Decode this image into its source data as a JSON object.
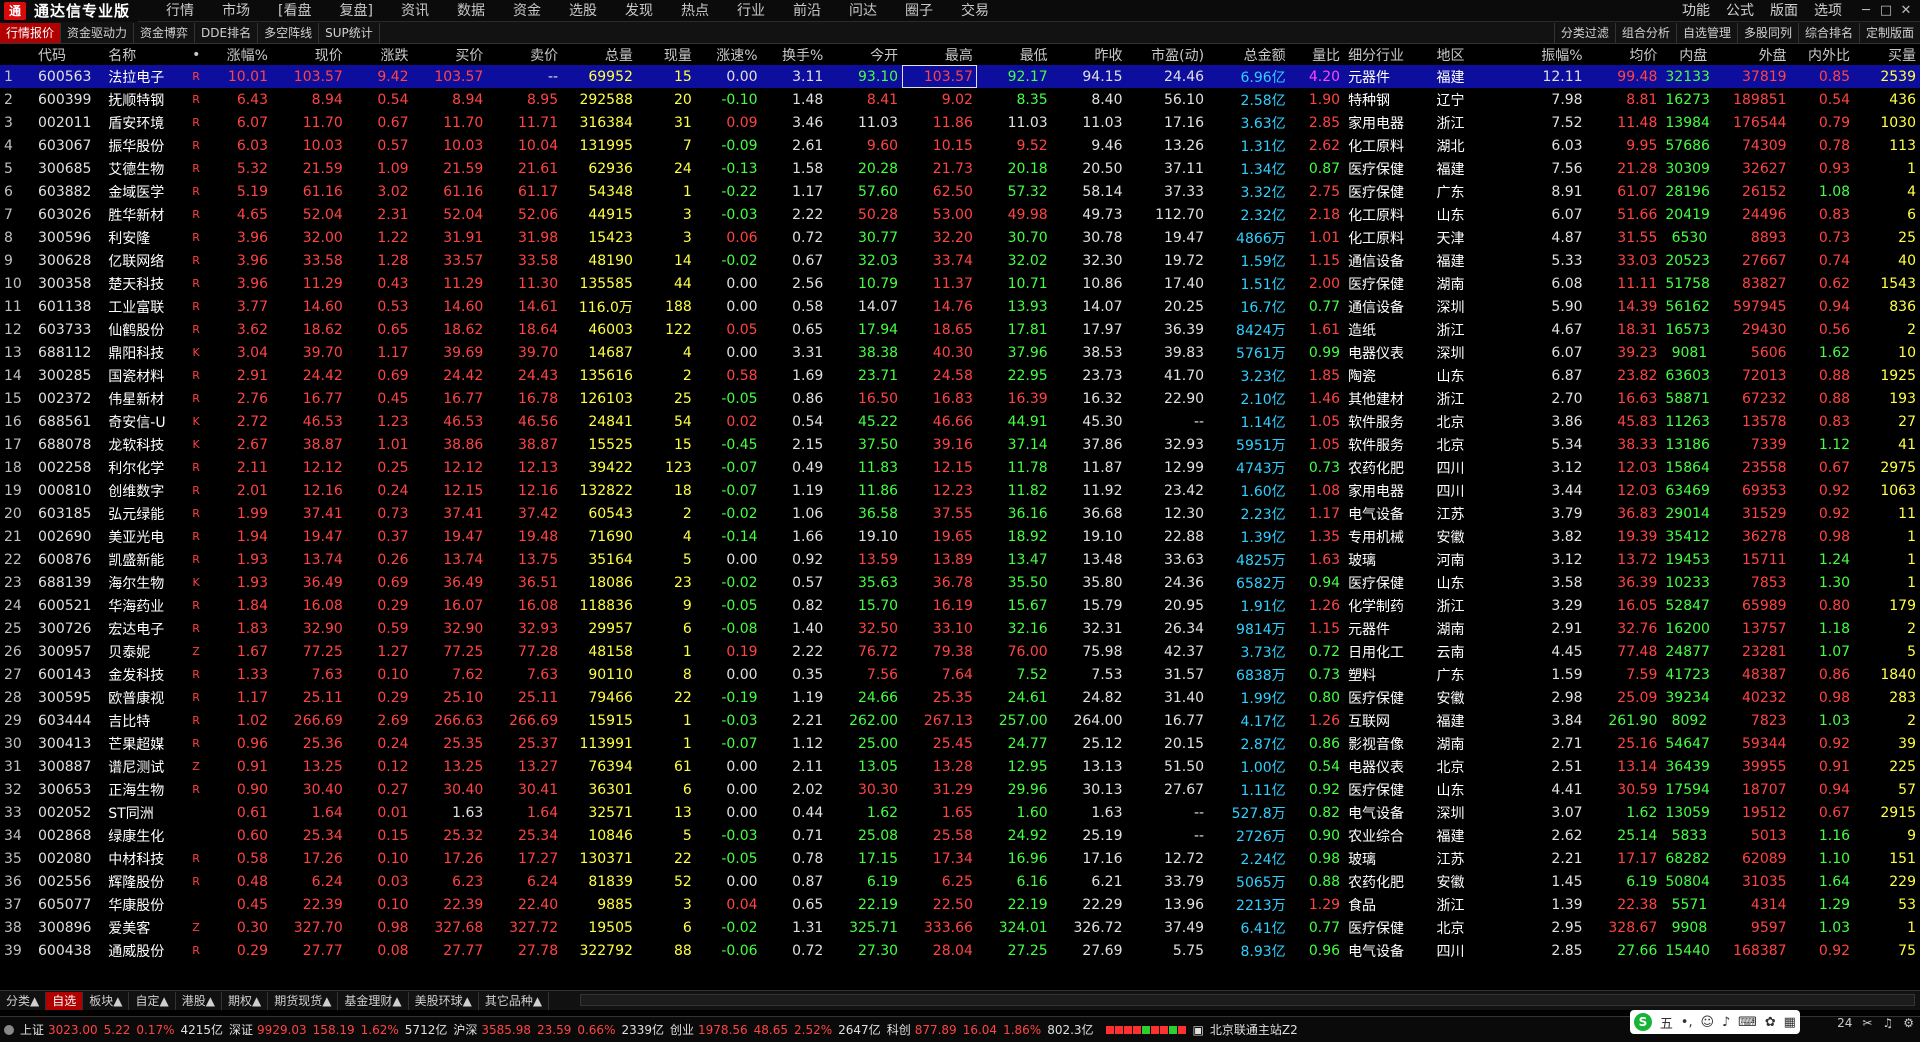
{
  "app": {
    "title": "通达信专业版",
    "logo": "通"
  },
  "menus": [
    "行情",
    "市场",
    "[看盘",
    "复盘]",
    "资讯",
    "数据",
    "资金",
    "选股",
    "发现",
    "热点",
    "行业",
    "前沿",
    "问达",
    "圈子",
    "交易"
  ],
  "right_menus": [
    "功能",
    "公式",
    "版面",
    "选项"
  ],
  "window_controls": [
    "─",
    "□",
    "✕"
  ],
  "sub_tabs": [
    "行情报价",
    "资金驱动力",
    "资金博弈",
    "DDE排名",
    "多空阵线",
    "SUP统计"
  ],
  "sub_tabs_right": [
    "分类过滤",
    "组合分析",
    "自选管理",
    "多股同列",
    "综合排名",
    "定制版面"
  ],
  "columns": [
    "",
    "代码",
    "名称",
    "•",
    "涨幅%",
    "现价",
    "涨跌",
    "买价",
    "卖价",
    "总量",
    "现量",
    "涨速%",
    "换手%",
    "今开",
    "最高",
    "最低",
    "昨收",
    "市盈(动)",
    "总金额",
    "量比",
    "细分行业",
    "地区",
    "振幅%",
    "均价",
    "内盘",
    "外盘",
    "内外比",
    "买量"
  ],
  "rows": [
    [
      "1",
      "600563",
      "法拉电子",
      "R",
      "10.01",
      "103.57",
      "9.42",
      "103.57",
      "--",
      "69952",
      "15",
      "0.00",
      "3.11",
      "93.10",
      "103.57",
      "92.17",
      "94.15",
      "24.46",
      "6.96亿",
      "4.20",
      "元器件",
      "福建",
      "12.11",
      "99.48",
      "32133",
      "37819",
      "0.85",
      "2539"
    ],
    [
      "2",
      "600399",
      "抚顺特钢",
      "R",
      "6.43",
      "8.94",
      "0.54",
      "8.94",
      "8.95",
      "292588",
      "20",
      "-0.10",
      "1.48",
      "8.41",
      "9.02",
      "8.35",
      "8.40",
      "56.10",
      "2.58亿",
      "1.90",
      "特种钢",
      "辽宁",
      "7.98",
      "8.81",
      "162737",
      "189851",
      "0.54",
      "436"
    ],
    [
      "3",
      "002011",
      "盾安环境",
      "R",
      "6.07",
      "11.70",
      "0.67",
      "11.70",
      "11.71",
      "316384",
      "31",
      "0.09",
      "3.46",
      "11.03",
      "11.86",
      "11.03",
      "11.03",
      "17.16",
      "3.63亿",
      "2.85",
      "家用电器",
      "浙江",
      "7.52",
      "11.48",
      "139840",
      "176544",
      "0.79",
      "1030"
    ],
    [
      "4",
      "603067",
      "振华股份",
      "R",
      "6.03",
      "10.03",
      "0.57",
      "10.03",
      "10.04",
      "131995",
      "7",
      "-0.09",
      "2.61",
      "9.60",
      "10.15",
      "9.52",
      "9.46",
      "13.26",
      "1.31亿",
      "2.62",
      "化工原料",
      "湖北",
      "6.03",
      "9.95",
      "57686",
      "74309",
      "0.78",
      "113"
    ],
    [
      "5",
      "300685",
      "艾德生物",
      "R",
      "5.32",
      "21.59",
      "1.09",
      "21.59",
      "21.61",
      "62936",
      "24",
      "-0.13",
      "1.58",
      "20.28",
      "21.73",
      "20.18",
      "20.50",
      "37.11",
      "1.34亿",
      "0.87",
      "医疗保健",
      "福建",
      "7.56",
      "21.28",
      "30309",
      "32627",
      "0.93",
      "1"
    ],
    [
      "6",
      "603882",
      "金域医学",
      "R",
      "5.19",
      "61.16",
      "3.02",
      "61.16",
      "61.17",
      "54348",
      "1",
      "-0.22",
      "1.17",
      "57.60",
      "62.50",
      "57.32",
      "58.14",
      "37.33",
      "3.32亿",
      "2.75",
      "医疗保健",
      "广东",
      "8.91",
      "61.07",
      "28196",
      "26152",
      "1.08",
      "4"
    ],
    [
      "7",
      "603026",
      "胜华新材",
      "R",
      "4.65",
      "52.04",
      "2.31",
      "52.04",
      "52.06",
      "44915",
      "3",
      "-0.03",
      "2.22",
      "50.28",
      "53.00",
      "49.98",
      "49.73",
      "112.70",
      "2.32亿",
      "2.18",
      "化工原料",
      "山东",
      "6.07",
      "51.66",
      "20419",
      "24496",
      "0.83",
      "6"
    ],
    [
      "8",
      "300596",
      "利安隆",
      "R",
      "3.96",
      "32.00",
      "1.22",
      "31.91",
      "31.98",
      "15423",
      "3",
      "0.06",
      "0.72",
      "30.77",
      "32.20",
      "30.70",
      "30.78",
      "19.47",
      "4866万",
      "1.01",
      "化工原料",
      "天津",
      "4.87",
      "31.55",
      "6530",
      "8893",
      "0.73",
      "25"
    ],
    [
      "9",
      "300628",
      "亿联网络",
      "R",
      "3.96",
      "33.58",
      "1.28",
      "33.57",
      "33.58",
      "48190",
      "14",
      "-0.02",
      "0.67",
      "32.03",
      "33.74",
      "32.02",
      "32.30",
      "19.72",
      "1.59亿",
      "1.15",
      "通信设备",
      "福建",
      "5.33",
      "33.03",
      "20523",
      "27667",
      "0.74",
      "40"
    ],
    [
      "10",
      "300358",
      "楚天科技",
      "R",
      "3.96",
      "11.29",
      "0.43",
      "11.29",
      "11.30",
      "135585",
      "44",
      "0.00",
      "2.56",
      "10.79",
      "11.37",
      "10.71",
      "10.86",
      "17.40",
      "1.51亿",
      "2.00",
      "医疗保健",
      "湖南",
      "6.08",
      "11.11",
      "51758",
      "83827",
      "0.62",
      "1543"
    ],
    [
      "11",
      "601138",
      "工业富联",
      "R",
      "3.77",
      "14.60",
      "0.53",
      "14.60",
      "14.61",
      "116.0万",
      "188",
      "0.00",
      "0.58",
      "14.07",
      "14.76",
      "13.93",
      "14.07",
      "20.25",
      "16.7亿",
      "0.77",
      "通信设备",
      "深圳",
      "5.90",
      "14.39",
      "561621",
      "597945",
      "0.94",
      "836"
    ],
    [
      "12",
      "603733",
      "仙鹤股份",
      "R",
      "3.62",
      "18.62",
      "0.65",
      "18.62",
      "18.64",
      "46003",
      "122",
      "0.05",
      "0.65",
      "17.94",
      "18.65",
      "17.81",
      "17.97",
      "36.39",
      "8424万",
      "1.61",
      "造纸",
      "浙江",
      "4.67",
      "18.31",
      "16573",
      "29430",
      "0.56",
      "2"
    ],
    [
      "13",
      "688112",
      "鼎阳科技",
      "K",
      "3.04",
      "39.70",
      "1.17",
      "39.69",
      "39.70",
      "14687",
      "4",
      "0.00",
      "3.31",
      "38.38",
      "40.30",
      "37.96",
      "38.53",
      "39.83",
      "5761万",
      "0.99",
      "电器仪表",
      "深圳",
      "6.07",
      "39.23",
      "9081",
      "5606",
      "1.62",
      "10"
    ],
    [
      "14",
      "300285",
      "国瓷材料",
      "R",
      "2.91",
      "24.42",
      "0.69",
      "24.42",
      "24.43",
      "135616",
      "2",
      "0.58",
      "1.69",
      "23.71",
      "24.58",
      "22.95",
      "23.73",
      "41.70",
      "3.23亿",
      "1.85",
      "陶瓷",
      "山东",
      "6.87",
      "23.82",
      "63603",
      "72013",
      "0.88",
      "1925"
    ],
    [
      "15",
      "002372",
      "伟星新材",
      "R",
      "2.76",
      "16.77",
      "0.45",
      "16.77",
      "16.78",
      "126103",
      "25",
      "-0.05",
      "0.86",
      "16.50",
      "16.83",
      "16.39",
      "16.32",
      "22.90",
      "2.10亿",
      "1.46",
      "其他建材",
      "浙江",
      "2.70",
      "16.63",
      "58871",
      "67232",
      "0.88",
      "193"
    ],
    [
      "16",
      "688561",
      "奇安信-U",
      "K",
      "2.72",
      "46.53",
      "1.23",
      "46.53",
      "46.56",
      "24841",
      "54",
      "0.02",
      "0.54",
      "45.22",
      "46.66",
      "44.91",
      "45.30",
      "--",
      "1.14亿",
      "1.05",
      "软件服务",
      "北京",
      "3.86",
      "45.83",
      "11263",
      "13578",
      "0.83",
      "27"
    ],
    [
      "17",
      "688078",
      "龙软科技",
      "K",
      "2.67",
      "38.87",
      "1.01",
      "38.86",
      "38.87",
      "15525",
      "15",
      "-0.45",
      "2.15",
      "37.50",
      "39.16",
      "37.14",
      "37.86",
      "32.93",
      "5951万",
      "1.05",
      "软件服务",
      "北京",
      "5.34",
      "38.33",
      "13186",
      "7339",
      "1.12",
      "41"
    ],
    [
      "18",
      "002258",
      "利尔化学",
      "R",
      "2.11",
      "12.12",
      "0.25",
      "12.12",
      "12.13",
      "39422",
      "123",
      "-0.07",
      "0.49",
      "11.83",
      "12.15",
      "11.78",
      "11.87",
      "12.99",
      "4743万",
      "0.73",
      "农药化肥",
      "四川",
      "3.12",
      "12.03",
      "15864",
      "23558",
      "0.67",
      "2975"
    ],
    [
      "19",
      "000810",
      "创维数字",
      "R",
      "2.01",
      "12.16",
      "0.24",
      "12.15",
      "12.16",
      "132822",
      "18",
      "-0.07",
      "1.19",
      "11.86",
      "12.23",
      "11.82",
      "11.92",
      "23.42",
      "1.60亿",
      "1.08",
      "家用电器",
      "四川",
      "3.44",
      "12.03",
      "63469",
      "69353",
      "0.92",
      "1063"
    ],
    [
      "20",
      "603185",
      "弘元绿能",
      "R",
      "1.99",
      "37.41",
      "0.73",
      "37.41",
      "37.42",
      "60543",
      "2",
      "-0.02",
      "1.06",
      "36.58",
      "37.55",
      "36.16",
      "36.68",
      "12.30",
      "2.23亿",
      "1.17",
      "电气设备",
      "江苏",
      "3.79",
      "36.83",
      "29014",
      "31529",
      "0.92",
      "11"
    ],
    [
      "21",
      "002690",
      "美亚光电",
      "R",
      "1.94",
      "19.47",
      "0.37",
      "19.47",
      "19.48",
      "71690",
      "4",
      "-0.14",
      "1.66",
      "19.10",
      "19.65",
      "18.92",
      "19.10",
      "22.88",
      "1.39亿",
      "1.35",
      "专用机械",
      "安徽",
      "3.82",
      "19.39",
      "35412",
      "36278",
      "0.98",
      "1"
    ],
    [
      "22",
      "600876",
      "凯盛新能",
      "R",
      "1.93",
      "13.74",
      "0.26",
      "13.74",
      "13.75",
      "35164",
      "5",
      "0.00",
      "0.92",
      "13.59",
      "13.89",
      "13.47",
      "13.48",
      "33.63",
      "4825万",
      "1.63",
      "玻璃",
      "河南",
      "3.12",
      "13.72",
      "19453",
      "15711",
      "1.24",
      "1"
    ],
    [
      "23",
      "688139",
      "海尔生物",
      "K",
      "1.93",
      "36.49",
      "0.69",
      "36.49",
      "36.51",
      "18086",
      "23",
      "-0.02",
      "0.57",
      "35.63",
      "36.78",
      "35.50",
      "35.80",
      "24.36",
      "6582万",
      "0.94",
      "医疗保健",
      "山东",
      "3.58",
      "36.39",
      "10233",
      "7853",
      "1.30",
      "1"
    ],
    [
      "24",
      "600521",
      "华海药业",
      "R",
      "1.84",
      "16.08",
      "0.29",
      "16.07",
      "16.08",
      "118836",
      "9",
      "-0.05",
      "0.82",
      "15.70",
      "16.19",
      "15.67",
      "15.79",
      "20.95",
      "1.91亿",
      "1.26",
      "化学制药",
      "浙江",
      "3.29",
      "16.05",
      "52847",
      "65989",
      "0.80",
      "179"
    ],
    [
      "25",
      "300726",
      "宏达电子",
      "R",
      "1.83",
      "32.90",
      "0.59",
      "32.90",
      "32.93",
      "29957",
      "6",
      "-0.08",
      "1.40",
      "32.50",
      "33.10",
      "32.16",
      "32.31",
      "26.34",
      "9814万",
      "1.15",
      "元器件",
      "湖南",
      "2.91",
      "32.76",
      "16200",
      "13757",
      "1.18",
      "2"
    ],
    [
      "26",
      "300957",
      "贝泰妮",
      "Z",
      "1.67",
      "77.25",
      "1.27",
      "77.25",
      "77.28",
      "48158",
      "1",
      "0.19",
      "2.22",
      "76.72",
      "79.38",
      "76.00",
      "75.98",
      "42.37",
      "3.73亿",
      "0.72",
      "日用化工",
      "云南",
      "4.45",
      "77.48",
      "24877",
      "23281",
      "1.07",
      "5"
    ],
    [
      "27",
      "600143",
      "金发科技",
      "R",
      "1.33",
      "7.63",
      "0.10",
      "7.62",
      "7.63",
      "90110",
      "8",
      "0.00",
      "0.35",
      "7.56",
      "7.64",
      "7.52",
      "7.53",
      "31.57",
      "6838万",
      "0.73",
      "塑料",
      "广东",
      "1.59",
      "7.59",
      "41723",
      "48387",
      "0.86",
      "1840"
    ],
    [
      "28",
      "300595",
      "欧普康视",
      "R",
      "1.17",
      "25.11",
      "0.29",
      "25.10",
      "25.11",
      "79466",
      "22",
      "-0.19",
      "1.19",
      "24.66",
      "25.35",
      "24.61",
      "24.82",
      "31.40",
      "1.99亿",
      "0.80",
      "医疗保健",
      "安徽",
      "2.98",
      "25.09",
      "39234",
      "40232",
      "0.98",
      "283"
    ],
    [
      "29",
      "603444",
      "吉比特",
      "R",
      "1.02",
      "266.69",
      "2.69",
      "266.63",
      "266.69",
      "15915",
      "1",
      "-0.03",
      "2.21",
      "262.00",
      "267.13",
      "257.00",
      "264.00",
      "16.77",
      "4.17亿",
      "1.26",
      "互联网",
      "福建",
      "3.84",
      "261.90",
      "8092",
      "7823",
      "1.03",
      "2"
    ],
    [
      "30",
      "300413",
      "芒果超媒",
      "R",
      "0.96",
      "25.36",
      "0.24",
      "25.35",
      "25.37",
      "113991",
      "1",
      "-0.07",
      "1.12",
      "25.00",
      "25.45",
      "24.77",
      "25.12",
      "20.15",
      "2.87亿",
      "0.86",
      "影视音像",
      "湖南",
      "2.71",
      "25.16",
      "54647",
      "59344",
      "0.92",
      "39"
    ],
    [
      "31",
      "300887",
      "谱尼测试",
      "Z",
      "0.91",
      "13.25",
      "0.12",
      "13.25",
      "13.27",
      "76394",
      "61",
      "0.00",
      "2.11",
      "13.05",
      "13.28",
      "12.95",
      "13.13",
      "51.50",
      "1.00亿",
      "0.54",
      "电器仪表",
      "北京",
      "2.51",
      "13.14",
      "36439",
      "39955",
      "0.91",
      "225"
    ],
    [
      "32",
      "300653",
      "正海生物",
      "R",
      "0.90",
      "30.40",
      "0.27",
      "30.40",
      "30.41",
      "36301",
      "6",
      "0.00",
      "2.02",
      "30.30",
      "31.29",
      "29.96",
      "30.13",
      "27.67",
      "1.11亿",
      "0.92",
      "医疗保健",
      "山东",
      "4.41",
      "30.59",
      "17594",
      "18707",
      "0.94",
      "57"
    ],
    [
      "33",
      "002052",
      "ST同洲",
      "",
      "0.61",
      "1.64",
      "0.01",
      "1.63",
      "1.64",
      "32571",
      "13",
      "0.00",
      "0.44",
      "1.62",
      "1.65",
      "1.60",
      "1.63",
      "--",
      "527.8万",
      "0.82",
      "电气设备",
      "深圳",
      "3.07",
      "1.62",
      "13059",
      "19512",
      "0.67",
      "2915"
    ],
    [
      "34",
      "002868",
      "绿康生化",
      "",
      "0.60",
      "25.34",
      "0.15",
      "25.32",
      "25.34",
      "10846",
      "5",
      "-0.03",
      "0.71",
      "25.08",
      "25.58",
      "24.92",
      "25.19",
      "--",
      "2726万",
      "0.90",
      "农业综合",
      "福建",
      "2.62",
      "25.14",
      "5833",
      "5013",
      "1.16",
      "9"
    ],
    [
      "35",
      "002080",
      "中材科技",
      "R",
      "0.58",
      "17.26",
      "0.10",
      "17.26",
      "17.27",
      "130371",
      "22",
      "-0.05",
      "0.78",
      "17.15",
      "17.34",
      "16.96",
      "17.16",
      "12.72",
      "2.24亿",
      "0.98",
      "玻璃",
      "江苏",
      "2.21",
      "17.17",
      "68282",
      "62089",
      "1.10",
      "151"
    ],
    [
      "36",
      "002556",
      "辉隆股份",
      "R",
      "0.48",
      "6.24",
      "0.03",
      "6.23",
      "6.24",
      "81839",
      "52",
      "0.00",
      "0.87",
      "6.19",
      "6.25",
      "6.16",
      "6.21",
      "33.79",
      "5065万",
      "0.88",
      "农药化肥",
      "安徽",
      "1.45",
      "6.19",
      "50804",
      "31035",
      "1.64",
      "229"
    ],
    [
      "37",
      "605077",
      "华康股份",
      "",
      "0.45",
      "22.39",
      "0.10",
      "22.39",
      "22.40",
      "9885",
      "3",
      "0.04",
      "0.65",
      "22.19",
      "22.50",
      "22.19",
      "22.29",
      "13.96",
      "2213万",
      "1.29",
      "食品",
      "浙江",
      "1.39",
      "22.38",
      "5571",
      "4314",
      "1.29",
      "53"
    ],
    [
      "38",
      "300896",
      "爱美客",
      "Z",
      "0.30",
      "327.70",
      "0.98",
      "327.68",
      "327.72",
      "19505",
      "6",
      "-0.02",
      "1.31",
      "325.71",
      "333.66",
      "324.01",
      "326.72",
      "37.49",
      "6.41亿",
      "0.77",
      "医疗保健",
      "北京",
      "2.95",
      "328.67",
      "9908",
      "9597",
      "1.03",
      "1"
    ],
    [
      "39",
      "600438",
      "通威股份",
      "R",
      "0.29",
      "27.77",
      "0.08",
      "27.77",
      "27.78",
      "322792",
      "88",
      "-0.06",
      "0.72",
      "27.30",
      "28.04",
      "27.25",
      "27.69",
      "5.75",
      "8.93亿",
      "0.96",
      "电气设备",
      "四川",
      "2.85",
      "27.66",
      "154405",
      "168387",
      "0.92",
      "75"
    ]
  ],
  "bottom_tabs": [
    "分类▲",
    "自选",
    "板块▲",
    "自定▲",
    "港股▲",
    "期权▲",
    "期货现货▲",
    "基金理财▲",
    "美股环球▲",
    "其它品种▲"
  ],
  "status": {
    "sh_label": "上证",
    "sh_value": "3023.00",
    "sh_change": "5.22",
    "sh_pct": "0.17%",
    "sh_amount": "4215亿",
    "sz_label": "深证",
    "sz_value": "9929.03",
    "sz_change": "158.19",
    "sz_pct": "1.62%",
    "sz_amount": "5712亿",
    "hs_label": "沪深",
    "hs_value": "3585.98",
    "hs_change": "23.59",
    "hs_pct": "0.66%",
    "hs_amount": "2339亿",
    "cy_label": "创业",
    "cy_value": "1978.56",
    "cy_change": "48.65",
    "cy_pct": "2.52%",
    "cy_amount": "2647亿",
    "kc_label": "科创",
    "kc_value": "877.89",
    "kc_change": "16.04",
    "kc_pct": "1.86%",
    "kc_amount": "802.3亿",
    "server": "北京联通主站Z2"
  },
  "ime": {
    "s": "S",
    "mode": "五",
    "time": "24"
  },
  "colors": {
    "up": "#ff4444",
    "down": "#44ff44",
    "volume": "#ffff44",
    "amount": "#30d0ff",
    "ratio": "#ff44ff",
    "selected_row": "#0d0d9e",
    "active_tab": "#b00000"
  }
}
